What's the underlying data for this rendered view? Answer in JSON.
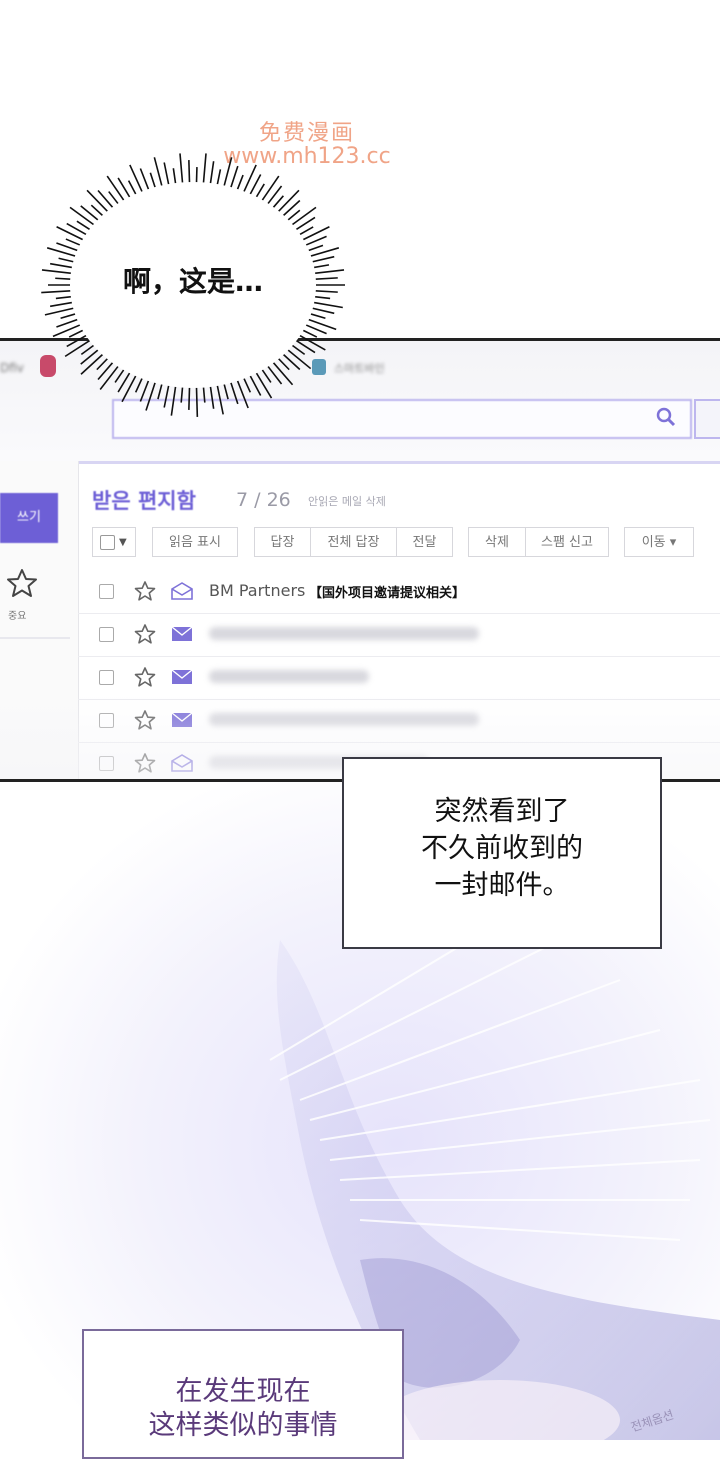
{
  "watermark": {
    "line1": "免费漫画",
    "line2": "www.mh123.cc"
  },
  "bubble": {
    "text": "啊，这是…"
  },
  "mail": {
    "topbar": {
      "logo_text": "Dfiv",
      "bookmark_text": "스마트바인"
    },
    "write_button": "쓰기",
    "important_label": "중요",
    "inbox_title": "받은 편지함",
    "inbox_count": "7 / 26",
    "unread_label": "안읽은 메일 삭제",
    "toolbar": {
      "mark_read": "읽음 표시",
      "reply": "답장",
      "reply_all": "전체 답장",
      "forward": "전달",
      "delete": "삭제",
      "spam": "스팸 신고",
      "move": "이동 ▾"
    },
    "first_row": {
      "sender": "BM Partners",
      "subject": "【国外项目邀请提议相关】"
    }
  },
  "narration1": {
    "line1": "突然看到了",
    "line2": "不久前收到的",
    "line3": "一封邮件。"
  },
  "narration2": {
    "line1": "在发生现在",
    "line2": "这样类似的事情"
  },
  "corner_label": "전체옵션",
  "colors": {
    "accent": "#6d5fd6",
    "narration_text": "#5a3a7a",
    "watermark": "#f0a487"
  }
}
